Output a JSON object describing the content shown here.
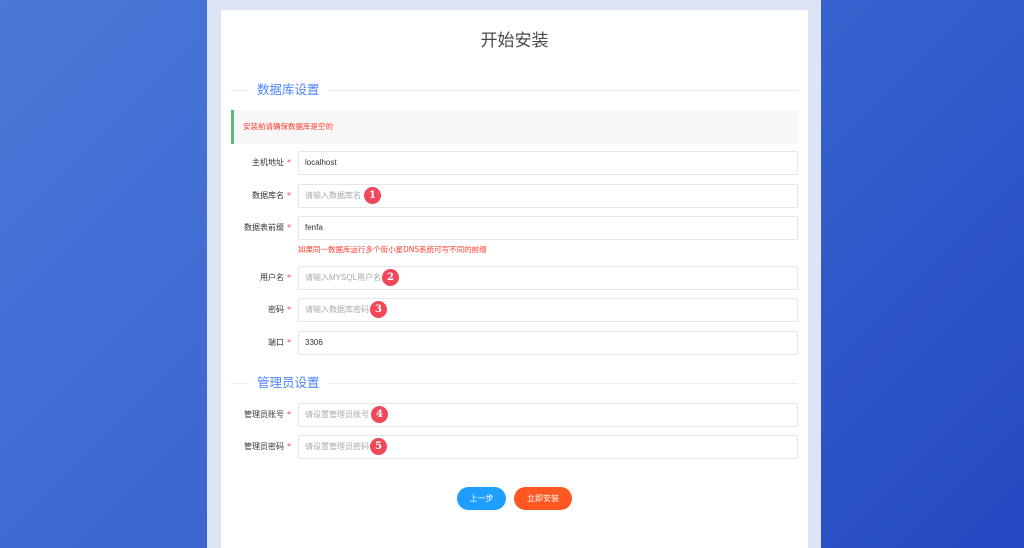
{
  "page": {
    "title": "开始安装"
  },
  "database": {
    "legend": "数据库设置",
    "notice": "安装前请确保数据库是空的",
    "required_mark": "*",
    "fields": {
      "host": {
        "label": "主机地址",
        "value": "localhost",
        "placeholder": ""
      },
      "dbname": {
        "label": "数据库名",
        "value": "",
        "placeholder": "请输入数据库名",
        "badge": "1"
      },
      "prefix": {
        "label": "数据表前缀",
        "value": "fenfa",
        "placeholder": "",
        "hint": "如果同一数据库运行多个街小星DNS系统可写不同的前缀"
      },
      "username": {
        "label": "用户名",
        "value": "",
        "placeholder": "请输入MYSQL用户名",
        "badge": "2"
      },
      "password": {
        "label": "密码",
        "value": "",
        "placeholder": "请输入数据库密码",
        "badge": "3"
      },
      "port": {
        "label": "端口",
        "value": "3306",
        "placeholder": ""
      }
    }
  },
  "admin": {
    "legend": "管理员设置",
    "fields": {
      "account": {
        "label": "管理员账号",
        "value": "",
        "placeholder": "请设置管理员账号",
        "badge": "4"
      },
      "password": {
        "label": "管理员密码",
        "value": "",
        "placeholder": "请设置管理员密码",
        "badge": "5"
      }
    }
  },
  "actions": {
    "prev_label": "上一步",
    "install_label": "立即安装"
  },
  "colors": {
    "accent": "#4c84ff",
    "prev_button": "#1e9fff",
    "install_button": "#ff5722",
    "badge": "#f0475a",
    "notice_border": "#5fb878",
    "error_text": "#ff3b30"
  }
}
